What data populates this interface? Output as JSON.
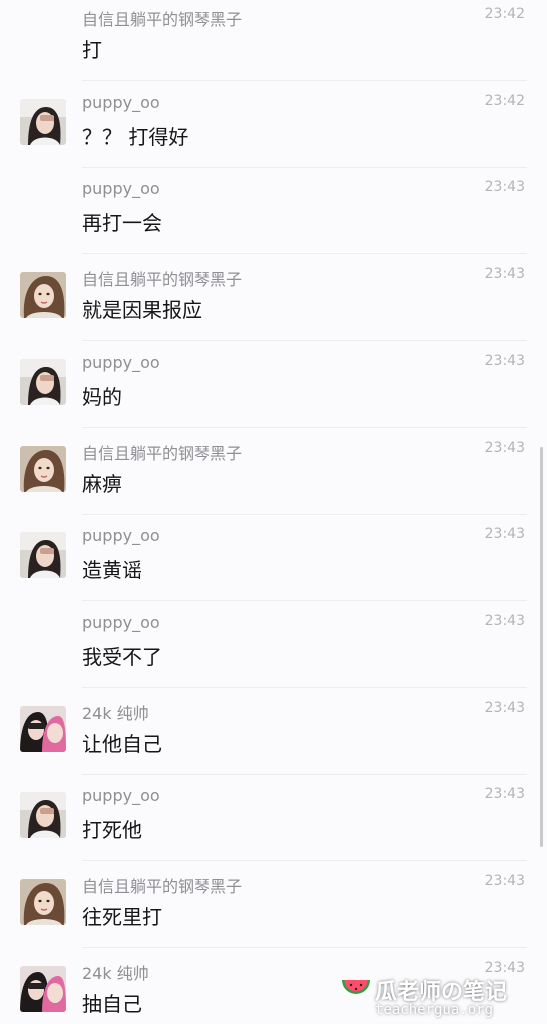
{
  "messages": [
    {
      "avatar": "",
      "name": "自信且躺平的钢琴黑子",
      "time": "23:42",
      "text": "打"
    },
    {
      "avatar": "puppy",
      "name": "puppy_oo",
      "time": "23:42",
      "text": "？？ 打得好"
    },
    {
      "avatar": "",
      "name": "puppy_oo",
      "time": "23:43",
      "text": "再打一会"
    },
    {
      "avatar": "heizi",
      "name": "自信且躺平的钢琴黑子",
      "time": "23:43",
      "text": "就是因果报应"
    },
    {
      "avatar": "puppy",
      "name": "puppy_oo",
      "time": "23:43",
      "text": "妈的"
    },
    {
      "avatar": "heizi",
      "name": "自信且躺平的钢琴黑子",
      "time": "23:43",
      "text": "麻痹"
    },
    {
      "avatar": "puppy",
      "name": "puppy_oo",
      "time": "23:43",
      "text": "造黄谣"
    },
    {
      "avatar": "",
      "name": "puppy_oo",
      "time": "23:43",
      "text": "我受不了"
    },
    {
      "avatar": "24k",
      "name": "24k 纯帅",
      "time": "23:43",
      "text": "让他自己"
    },
    {
      "avatar": "puppy",
      "name": "puppy_oo",
      "time": "23:43",
      "text": "打死他"
    },
    {
      "avatar": "heizi",
      "name": "自信且躺平的钢琴黑子",
      "time": "23:43",
      "text": "往死里打"
    },
    {
      "avatar": "24k",
      "name": "24k 纯帅",
      "time": "23:43",
      "text": "抽自己"
    }
  ],
  "watermark": {
    "title": "瓜老师の笔记",
    "url": "teachergua.org",
    "icon": "watermelon-icon"
  },
  "colors": {
    "background": "#fbfbfd",
    "name": "#8f8f94",
    "time": "#b4b4b8",
    "message": "#161616",
    "divider": "#ececef"
  }
}
